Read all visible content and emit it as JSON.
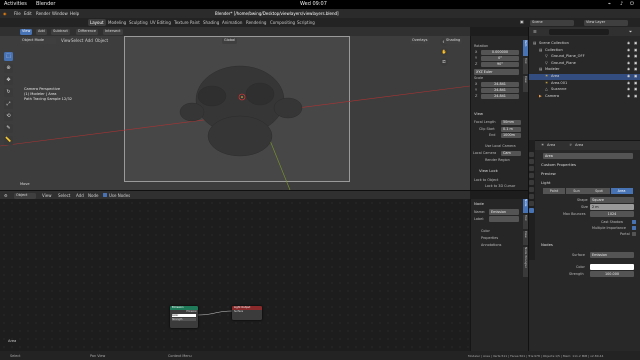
{
  "topbar": {
    "activities": "Activities",
    "app": "Blender",
    "clock": "Wed 09:07",
    "title": "Blender* [/home/bwing/Desktop/viewlayers/viewlayers.blend]"
  },
  "menubar": {
    "items": [
      "File",
      "Edit",
      "Render",
      "Window",
      "Help"
    ]
  },
  "workspace_tabs": {
    "items": [
      "Layout",
      "Modeling",
      "Sculpting",
      "UV Editing",
      "Texture Paint",
      "Shading",
      "Animation",
      "Rendering",
      "Compositing",
      "Scripting"
    ],
    "active": "Layout"
  },
  "scene": {
    "icon": "scene-icon",
    "scene_name": "Scene",
    "view_layer": "View Layer"
  },
  "viewport_header": {
    "mode_buttons": [
      "View",
      "Add",
      "Subtract",
      "Difference",
      "Intersect"
    ],
    "object_mode": "Object Mode",
    "menus": [
      "View",
      "Select",
      "Add",
      "Object"
    ],
    "orientation": "Global",
    "overlays": "Overlays",
    "shading": "Shading"
  },
  "viewport_overlay": {
    "line1": "Camera Perspective",
    "line2": "(1) Modeler | Area",
    "line3": "Path Tracing Sample 12/32",
    "move_label": "Move"
  },
  "nsidebar": {
    "rotation_label": "Rotation",
    "rotation": [
      {
        "axis": "X",
        "value": "0.000000"
      },
      {
        "axis": "Y",
        "value": "0°"
      },
      {
        "axis": "Z",
        "value": "90°"
      }
    ],
    "euler_label": "XYZ Euler",
    "scale_label": "Scale",
    "scale": [
      {
        "axis": "X",
        "value": "24.841"
      },
      {
        "axis": "Y",
        "value": "24.841"
      },
      {
        "axis": "Z",
        "value": "24.841"
      }
    ],
    "view_header": "View",
    "focal_length_label": "Focal Length",
    "focal_length_value": "50mm",
    "clip_start_label": "Clip Start",
    "clip_start_value": "0.1 m",
    "end_label": "End",
    "end_value": "1000m",
    "local_camera_label": "Use Local Camera",
    "local_camera_label2": "Local Camera",
    "local_camera_value": "Cam",
    "render_region_label": "Render Region",
    "view_lock_header": "View Lock",
    "lock_to_object_label": "Lock to Object",
    "lock_to_3d_cursor": "Lock to 3D Cursor",
    "tabs": [
      "Item",
      "Tool",
      "View"
    ]
  },
  "node_header": {
    "editor_type": "Object",
    "menus": [
      "View",
      "Select",
      "Add",
      "Node"
    ],
    "use_nodes": "Use Nodes"
  },
  "node_panel": {
    "node_header": "Node",
    "name_label": "Name:",
    "name_value": "Emission",
    "label_label": "Label:",
    "color_label": "Color",
    "properties_label": "Properties",
    "annotations_label": "Annotations",
    "tabs": [
      "Node",
      "Tool",
      "View",
      "Node Wrangler"
    ]
  },
  "nodes": {
    "emission": {
      "title": "Emission",
      "color": "#1f7a5a",
      "output": "Emission",
      "color_label": "Color",
      "strength": "Strength"
    },
    "output": {
      "title": "Light Output",
      "color": "#8a2a2a",
      "input": "Surface"
    }
  },
  "area_label": "Area",
  "outliner": {
    "items": [
      {
        "label": "Scene Collection",
        "icon": "collection-icon",
        "indent": 0,
        "selected": false
      },
      {
        "label": "Collection",
        "icon": "collection-icon",
        "indent": 1,
        "selected": false
      },
      {
        "label": "Ground_Plane_OFF",
        "icon": "object-icon",
        "indent": 2,
        "selected": false
      },
      {
        "label": "Ground_Plane",
        "icon": "object-icon",
        "indent": 2,
        "selected": false
      },
      {
        "label": "Modeler",
        "icon": "collection-icon",
        "indent": 1,
        "selected": false
      },
      {
        "label": "Area",
        "icon": "light-icon",
        "indent": 2,
        "selected": true
      },
      {
        "label": "Area.001",
        "icon": "light-icon",
        "indent": 2,
        "selected": false
      },
      {
        "label": "Suzanne",
        "icon": "mesh-icon",
        "indent": 2,
        "selected": false
      },
      {
        "label": "Camera",
        "icon": "camera-icon",
        "indent": 1,
        "selected": false
      }
    ]
  },
  "properties": {
    "object_name": "Area",
    "data_name": "Area",
    "datablock": "Area",
    "sections": [
      "Custom Properties",
      "Preview",
      "Light"
    ],
    "light_types": [
      "Point",
      "Sun",
      "Spot",
      "Area"
    ],
    "active_light_type": "Area",
    "shape_label": "Shape",
    "shape_value": "Square",
    "size_label": "Size",
    "size_value": "2 m",
    "max_bounces_label": "Max Bounces",
    "max_bounces_value": "1024",
    "cast_shadow": "Cast Shadow",
    "multiple_importance": "Multiple Importance",
    "portal": "Portal",
    "nodes_header": "Nodes",
    "surface_label": "Surface",
    "surface_value": "Emission",
    "color_label": "Color",
    "strength_label": "Strength",
    "strength_value": "100.000"
  },
  "statusbar": {
    "left": "Select",
    "middle1": "Pan View",
    "middle2": "Context Menu",
    "right": "Modeler | Area | Verts:511 | Faces:501 | Tris:978 | Objects:1/5 | Mem: 111.2 MiB | v2.80.44"
  }
}
